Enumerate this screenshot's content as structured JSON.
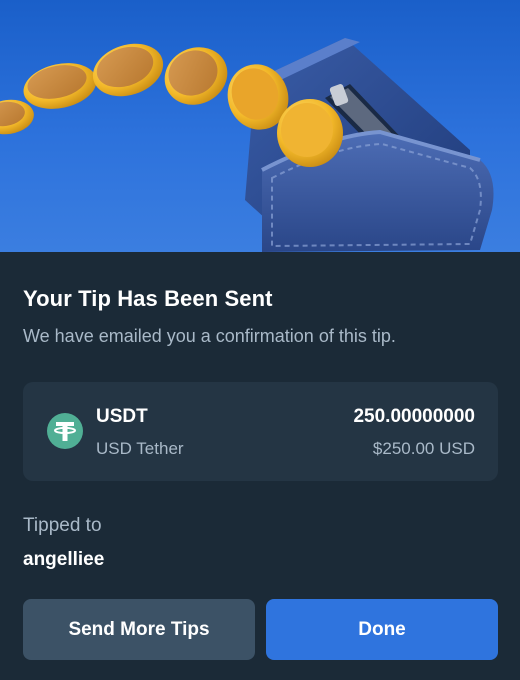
{
  "hero": {
    "illustration": "wallet-with-coins"
  },
  "dialog": {
    "title": "Your Tip Has Been Sent",
    "subtitle": "We have emailed you a confirmation of this tip."
  },
  "token": {
    "icon": "tether-icon",
    "icon_color": "#50af95",
    "symbol": "USDT",
    "name": "USD Tether",
    "amount": "250.00000000",
    "usd_value": "$250.00 USD"
  },
  "recipient": {
    "label": "Tipped to",
    "username": "angelliee"
  },
  "actions": {
    "send_more_label": "Send More Tips",
    "done_label": "Done"
  },
  "colors": {
    "background": "#1b2a37",
    "card": "#243544",
    "primary_button": "#2f74de",
    "secondary_button": "#3c5266",
    "muted_text": "#a9b9c8"
  }
}
